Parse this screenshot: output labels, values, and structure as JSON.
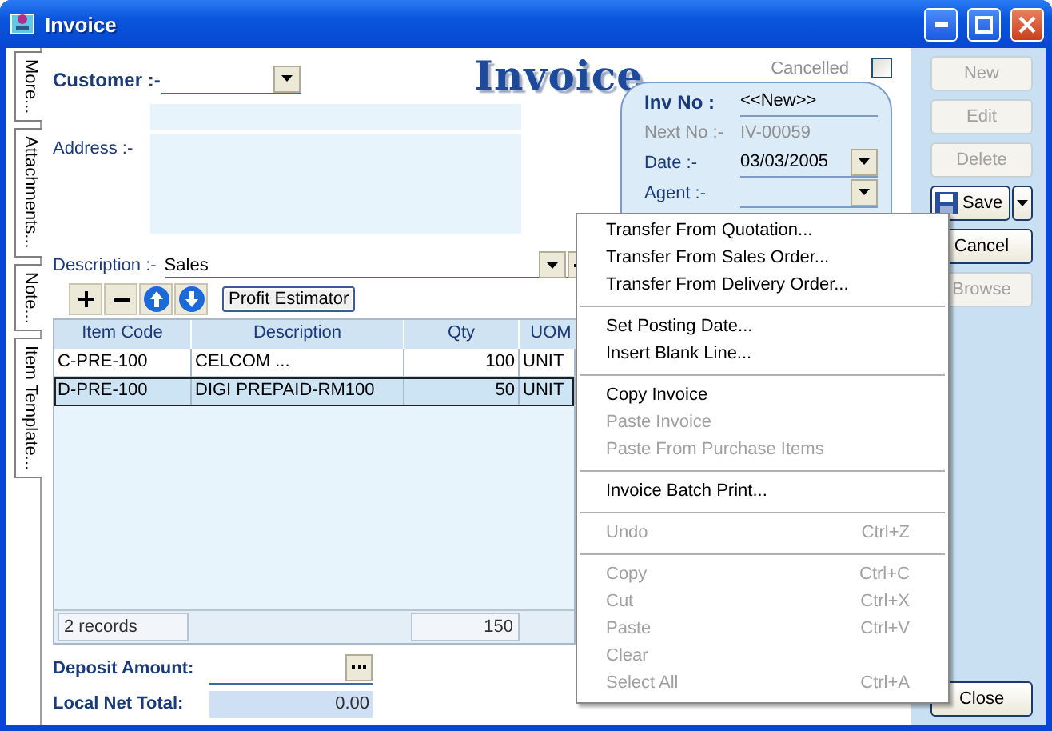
{
  "window": {
    "title": "Invoice"
  },
  "side_tabs": [
    {
      "label": "More..."
    },
    {
      "label": "Attachments..."
    },
    {
      "label": "Note..."
    },
    {
      "label": "Item Template..."
    }
  ],
  "customer": {
    "label": "Customer :-"
  },
  "heading": "Invoice",
  "cancelled": {
    "label": "Cancelled",
    "checked": false
  },
  "address": {
    "label": "Address :-"
  },
  "inv_panel": {
    "inv_no_label": "Inv No :",
    "inv_no": "<<New>>",
    "next_no_label": "Next No :-",
    "next_no": "IV-00059",
    "date_label": "Date :-",
    "date": "03/03/2005",
    "agent_label": "Agent :-"
  },
  "description": {
    "label": "Description :-",
    "value": "Sales"
  },
  "grid_toolbar": {
    "tools": [
      {
        "kind": "add"
      },
      {
        "kind": "remove"
      },
      {
        "kind": "up"
      },
      {
        "kind": "down"
      }
    ],
    "profit_estimator": "Profit Estimator"
  },
  "grid": {
    "columns": [
      "Item Code",
      "Description",
      "Qty",
      "UOM"
    ],
    "rows": [
      {
        "cells": [
          "C-PRE-100",
          "CELCOM ...",
          "100",
          "UNIT"
        ],
        "selected": false
      },
      {
        "cells": [
          "D-PRE-100",
          "DIGI PREPAID-RM100",
          "50",
          "UNIT"
        ],
        "selected": true
      }
    ],
    "footer": {
      "records": "2 records",
      "qty_total": "150"
    }
  },
  "deposit": {
    "label": "Deposit Amount:"
  },
  "local_net_total": {
    "label": "Local Net Total:",
    "value": "0.00"
  },
  "actions": [
    {
      "kind": "button",
      "label": "New",
      "disabled": true
    },
    {
      "kind": "button",
      "label": "Edit",
      "disabled": true
    },
    {
      "kind": "button",
      "label": "Delete",
      "disabled": true
    },
    {
      "kind": "split",
      "label": "Save",
      "disabled": false
    },
    {
      "kind": "button",
      "label": "Cancel",
      "disabled": false
    },
    {
      "kind": "button",
      "label": "Browse",
      "disabled": true
    },
    {
      "kind": "spacer"
    },
    {
      "kind": "button",
      "label": "Close",
      "disabled": false
    }
  ],
  "context_menu": [
    {
      "kind": "item",
      "label": "Transfer From Quotation...",
      "disabled": false
    },
    {
      "kind": "item",
      "label": "Transfer From Sales Order...",
      "disabled": false
    },
    {
      "kind": "item",
      "label": "Transfer From Delivery Order...",
      "disabled": false
    },
    {
      "kind": "separator"
    },
    {
      "kind": "item",
      "label": "Set Posting Date...",
      "disabled": false
    },
    {
      "kind": "item",
      "label": "Insert Blank Line...",
      "disabled": false
    },
    {
      "kind": "separator"
    },
    {
      "kind": "item",
      "label": "Copy Invoice",
      "disabled": false
    },
    {
      "kind": "item",
      "label": "Paste Invoice",
      "disabled": true
    },
    {
      "kind": "item",
      "label": "Paste From Purchase Items",
      "disabled": true
    },
    {
      "kind": "separator"
    },
    {
      "kind": "item",
      "label": "Invoice Batch Print...",
      "disabled": false
    },
    {
      "kind": "separator"
    },
    {
      "kind": "item",
      "label": "Undo",
      "shortcut": "Ctrl+Z",
      "disabled": true
    },
    {
      "kind": "separator"
    },
    {
      "kind": "item",
      "label": "Copy",
      "shortcut": "Ctrl+C",
      "disabled": true
    },
    {
      "kind": "item",
      "label": "Cut",
      "shortcut": "Ctrl+X",
      "disabled": true
    },
    {
      "kind": "item",
      "label": "Paste",
      "shortcut": "Ctrl+V",
      "disabled": true
    },
    {
      "kind": "item",
      "label": "Clear",
      "disabled": true
    },
    {
      "kind": "item",
      "label": "Select All",
      "shortcut": "Ctrl+A",
      "disabled": true
    }
  ]
}
